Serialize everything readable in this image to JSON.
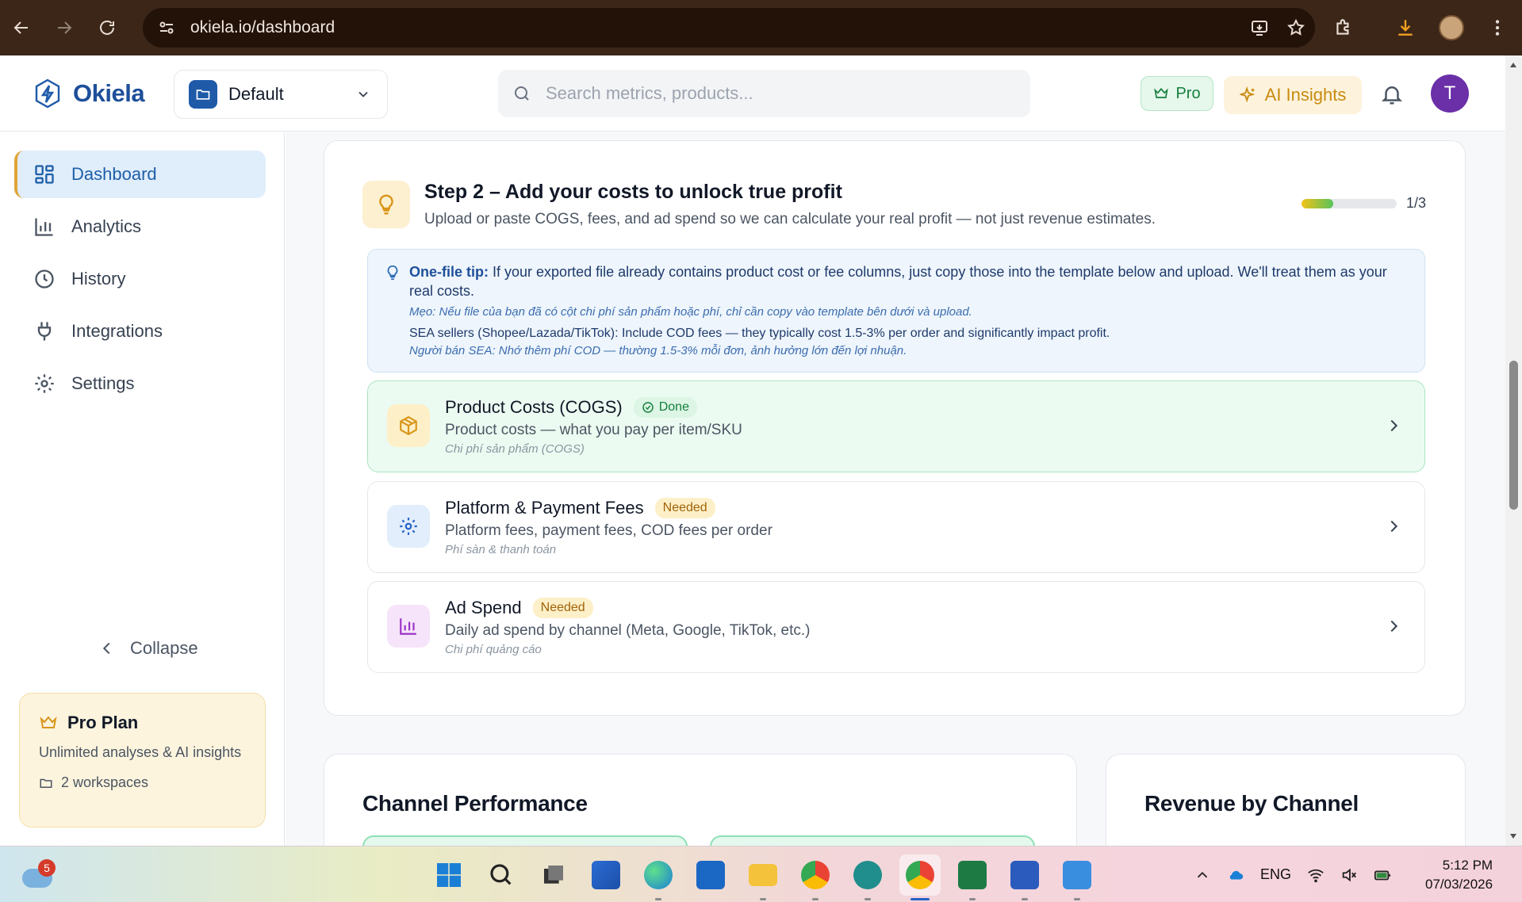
{
  "browser": {
    "url": "okiela.io/dashboard"
  },
  "header": {
    "brand": "Okiela",
    "workspace": "Default",
    "search_placeholder": "Search metrics, products...",
    "pro_label": "Pro",
    "ai_label": "AI Insights",
    "avatar_initial": "T"
  },
  "sidebar": {
    "items": [
      {
        "label": "Dashboard",
        "icon": "grid-icon",
        "active": true
      },
      {
        "label": "Analytics",
        "icon": "bar-chart-icon"
      },
      {
        "label": "History",
        "icon": "clock-icon"
      },
      {
        "label": "Integrations",
        "icon": "plug-icon"
      },
      {
        "label": "Settings",
        "icon": "gear-icon"
      }
    ],
    "collapse_label": "Collapse",
    "plan": {
      "title": "Pro Plan",
      "description": "Unlimited analyses & AI insights",
      "workspaces": "2 workspaces"
    }
  },
  "step": {
    "title": "Step 2 – Add your costs to unlock true profit",
    "subtitle": "Upload or paste COGS, fees, and ad spend so we can calculate your real profit — not just revenue estimates.",
    "progress_label": "1/3",
    "progress_fraction": 0.33,
    "tip": {
      "label": "One-file tip:",
      "text": "If your exported file already contains product cost or fee columns, just copy those into the template below and upload. We'll treat them as your real costs.",
      "vn": "Mẹo: Nếu file của bạn đã có cột chi phí sản phẩm hoặc phí, chỉ cần copy vào template bên dưới và upload.",
      "sea": "SEA sellers (Shopee/Lazada/TikTok): Include COD fees — they typically cost 1.5-3% per order and significantly impact profit.",
      "sea_vn": "Người bán SEA: Nhớ thêm phí COD — thường 1.5-3% mỗi đơn, ảnh hưởng lớn đến lợi nhuận."
    },
    "items": [
      {
        "title": "Product Costs (COGS)",
        "badge": "Done",
        "desc": "Product costs — what you pay per item/SKU",
        "vn": "Chi phí sản phẩm (COGS)",
        "icon": "package-icon"
      },
      {
        "title": "Platform & Payment Fees",
        "badge": "Needed",
        "desc": "Platform fees, payment fees, COD fees per order",
        "vn": "Phí sàn & thanh toán",
        "icon": "gear-icon"
      },
      {
        "title": "Ad Spend",
        "badge": "Needed",
        "desc": "Daily ad spend by channel (Meta, Google, TikTok, etc.)",
        "vn": "Chi phí quảng cáo",
        "icon": "bar-chart-icon"
      }
    ]
  },
  "panels": {
    "channel_performance": "Channel Performance",
    "revenue_by_channel": "Revenue by Channel"
  },
  "taskbar": {
    "notification_count": "5",
    "language": "ENG",
    "time": "5:12 PM",
    "date": "07/03/2026"
  },
  "colors": {
    "accent": "#1d5fa8",
    "done": "#15803d",
    "needed": "#a16207",
    "pro": "#d9961a"
  }
}
